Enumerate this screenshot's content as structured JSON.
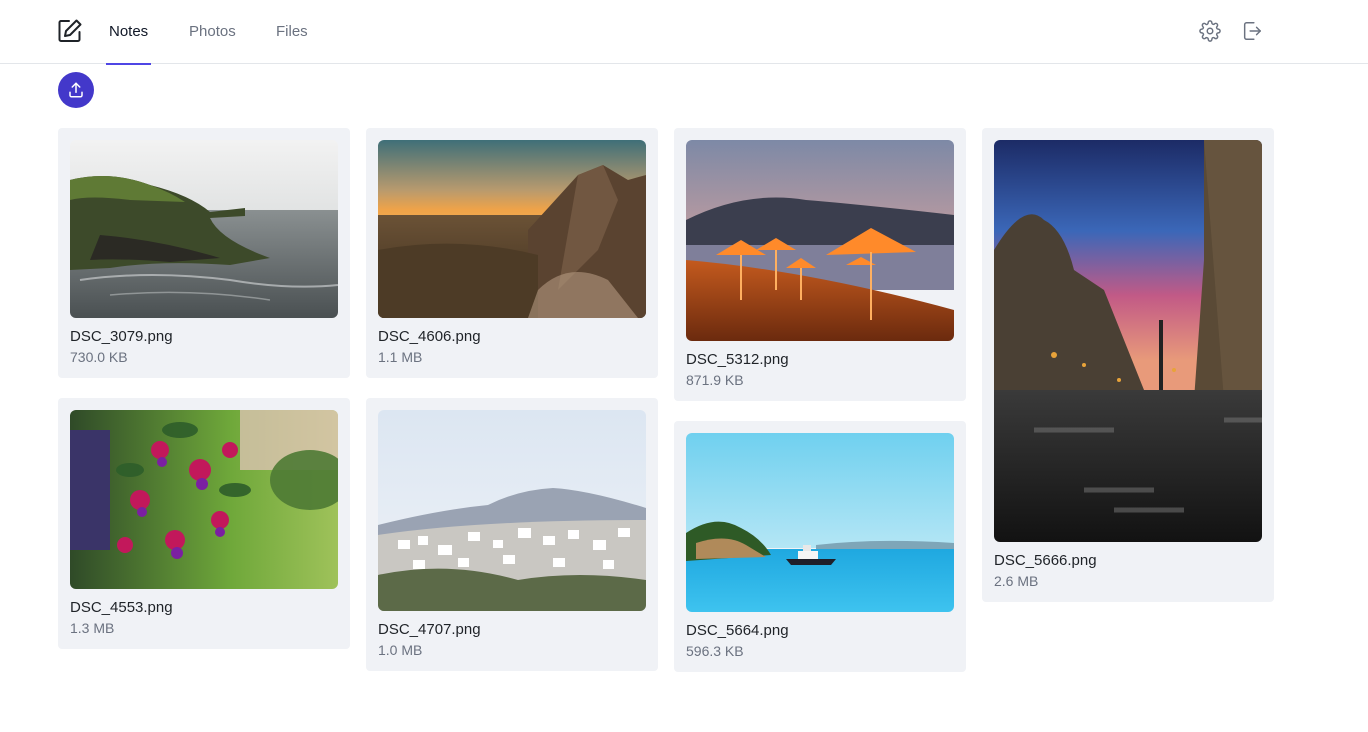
{
  "nav": {
    "tabs": [
      {
        "label": "Notes",
        "active": true
      },
      {
        "label": "Photos",
        "active": false
      },
      {
        "label": "Files",
        "active": false
      }
    ],
    "accent_color": "#4f46e5"
  },
  "icons": {
    "logo": "edit-note-icon",
    "settings": "gear-icon",
    "logout": "logout-icon",
    "upload": "upload-icon"
  },
  "photos": [
    {
      "name": "DSC_3079.png",
      "size": "730.0 KB"
    },
    {
      "name": "DSC_4606.png",
      "size": "1.1 MB"
    },
    {
      "name": "DSC_5312.png",
      "size": "871.9 KB"
    },
    {
      "name": "DSC_5666.png",
      "size": "2.6 MB"
    },
    {
      "name": "DSC_4553.png",
      "size": "1.3 MB"
    },
    {
      "name": "DSC_4707.png",
      "size": "1.0 MB"
    },
    {
      "name": "DSC_5664.png",
      "size": "596.3 KB"
    }
  ]
}
